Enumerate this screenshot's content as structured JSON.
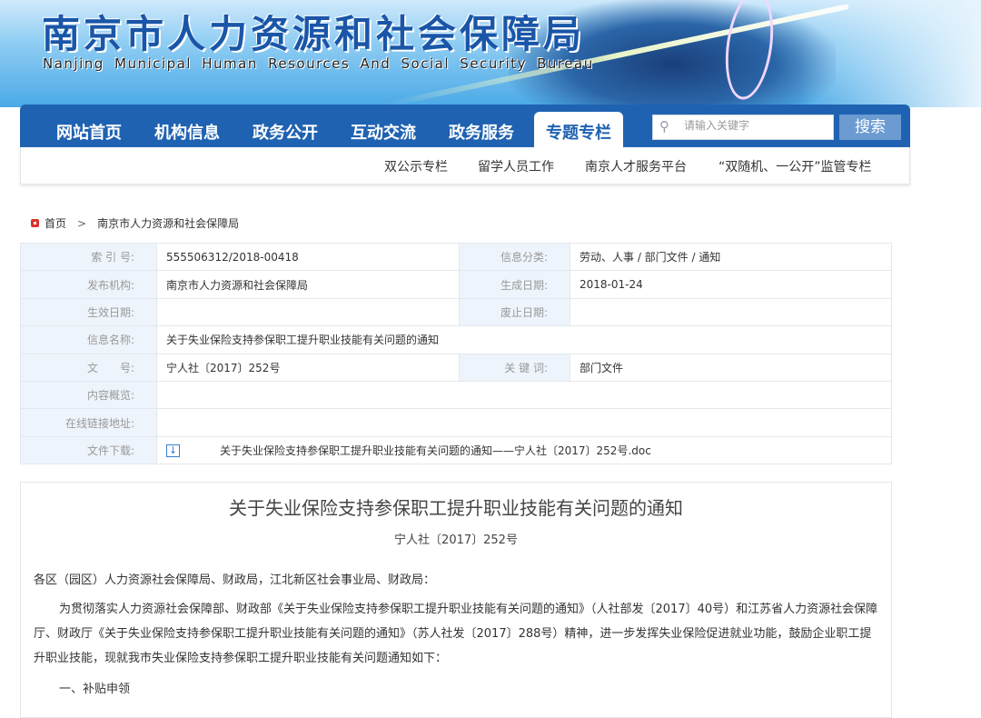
{
  "header": {
    "title_cn": "南京市人力资源和社会保障局",
    "title_en": "Nanjing Municipal Human Resources And Social Security Bureau"
  },
  "nav": {
    "items": [
      "网站首页",
      "机构信息",
      "政务公开",
      "互动交流",
      "政务服务",
      "专题专栏"
    ],
    "active": "专题专栏",
    "search_placeholder": "请输入关键字",
    "search_label": "搜索"
  },
  "subnav": {
    "items": [
      "双公示专栏",
      "留学人员工作",
      "南京人才服务平台",
      "“双随机、一公开”监管专栏"
    ]
  },
  "breadcrumb": {
    "home": "首页",
    "current": "南京市人力资源和社会保障局"
  },
  "meta": {
    "index_label": "索 引 号:",
    "index": "555506312/2018-00418",
    "category_label": "信息分类:",
    "category": "劳动、人事 / 部门文件 / 通知",
    "publisher_label": "发布机构:",
    "publisher": "南京市人力资源和社会保障局",
    "created_label": "生成日期:",
    "created": "2018-01-24",
    "effective_label": "生效日期:",
    "effective": "",
    "abolish_label": "废止日期:",
    "abolish": "",
    "name_label": "信息名称:",
    "name": "关于失业保险支持参保职工提升职业技能有关问题的通知",
    "docno_label": "文　　号:",
    "docno": "宁人社〔2017〕252号",
    "keywords_label": "关 键 词:",
    "keywords": "部门文件",
    "summary_label": "内容概览:",
    "summary": "",
    "link_label": "在线链接地址:",
    "link": "",
    "download_label": "文件下载:",
    "download": "关于失业保险支持参保职工提升职业技能有关问题的通知——宁人社〔2017〕252号.doc"
  },
  "article": {
    "title": "关于失业保险支持参保职工提升职业技能有关问题的通知",
    "number": "宁人社〔2017〕252号",
    "salutation": "各区（园区）人力资源社会保障局、财政局，江北新区社会事业局、财政局：",
    "body": "为贯彻落实人力资源社会保障部、财政部《关于失业保险支持参保职工提升职业技能有关问题的通知》（人社部发〔2017〕40号）和江苏省人力资源社会保障厅、财政厅《关于失业保险支持参保职工提升职业技能有关问题的通知》（苏人社发〔2017〕288号）精神，进一步发挥失业保险促进就业功能，鼓励企业职工提升职业技能，现就我市失业保险支持参保职工提升职业技能有关问题通知如下：",
    "section1": "一、补贴申领"
  }
}
